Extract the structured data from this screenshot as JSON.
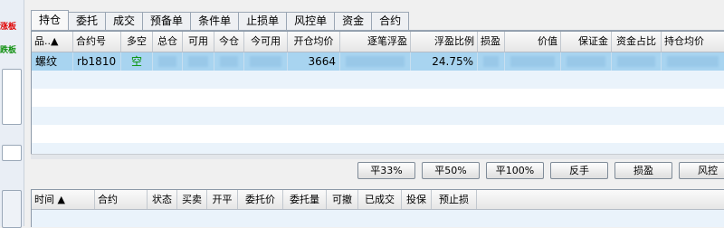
{
  "sidebar": {
    "label_red": "涨板",
    "label_green": "跌板"
  },
  "tabs": [
    {
      "label": "持仓",
      "active": true
    },
    {
      "label": "委托",
      "active": false
    },
    {
      "label": "成交",
      "active": false
    },
    {
      "label": "预备单",
      "active": false
    },
    {
      "label": "条件单",
      "active": false
    },
    {
      "label": "止损单",
      "active": false
    },
    {
      "label": "风控单",
      "active": false
    },
    {
      "label": "资金",
      "active": false
    },
    {
      "label": "合约",
      "active": false
    }
  ],
  "positions": {
    "columns": [
      "品..▲",
      "合约号",
      "多空",
      "总仓",
      "可用",
      "今仓",
      "今可用",
      "开仓均价",
      "逐笔浮盈",
      "浮盈比例",
      "损盈",
      "价值",
      "保证金",
      "资金占比",
      "持仓均价"
    ],
    "rows": [
      {
        "product": "螺纹",
        "contract": "rb1810",
        "direction": "空",
        "total": "",
        "available": "",
        "today": "",
        "today_available": "",
        "avg_open_price": "3664",
        "floating_pnl": "",
        "floating_pnl_ratio": "24.75%",
        "profit_loss": "",
        "value": "",
        "margin": "",
        "fund_ratio": "",
        "avg_position_price": ""
      }
    ]
  },
  "actions": [
    "平33%",
    "平50%",
    "平100%",
    "反手",
    "损盈",
    "风控"
  ],
  "orders": {
    "columns": [
      "时间 ▲",
      "合约",
      "状态",
      "买卖",
      "开平",
      "委托价",
      "委托量",
      "可撤",
      "已成交",
      "投保",
      "预止损"
    ]
  },
  "colors": {
    "selected_row": "#a8d4f0",
    "short_direction": "#009000",
    "limit_up": "#e00000",
    "limit_down": "#109010"
  }
}
